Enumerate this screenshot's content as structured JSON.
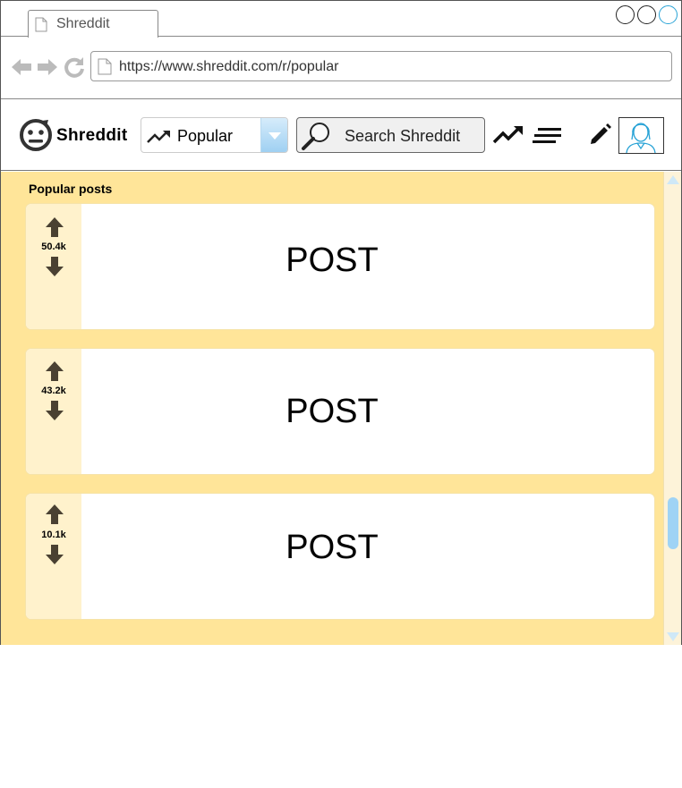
{
  "browser": {
    "tab_title": "Shreddit",
    "url": "https://www.shreddit.com/r/popular"
  },
  "header": {
    "brand": "Shreddit",
    "feed_select": "Popular",
    "search_placeholder": "Search Shreddit"
  },
  "feed": {
    "section_title": "Popular posts",
    "posts": [
      {
        "score": "50.4k",
        "label": "POST"
      },
      {
        "score": "43.2k",
        "label": "POST"
      },
      {
        "score": "10.1k",
        "label": "POST"
      }
    ]
  },
  "colors": {
    "content_bg": "#ffe599",
    "vote_column_bg": "#fff2cc",
    "accent_blue": "#9fd3f5"
  },
  "icons": {
    "back": "arrow-left-icon",
    "forward": "arrow-right-icon",
    "reload": "reload-icon",
    "logo": "shreddit-logo-icon",
    "trending": "trending-up-icon",
    "menu": "lines-icon",
    "pencil": "pencil-icon",
    "avatar": "user-avatar-icon"
  }
}
